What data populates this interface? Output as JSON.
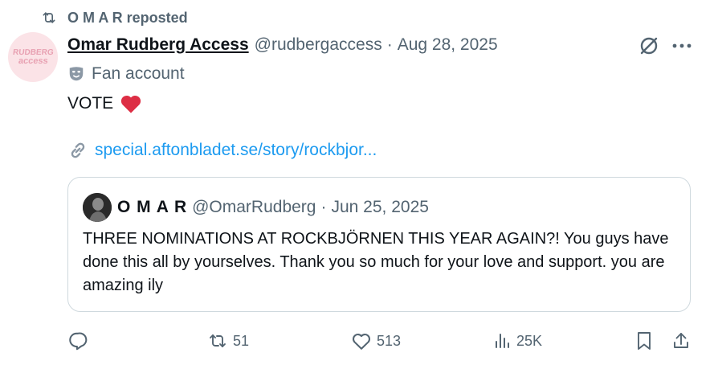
{
  "repost": {
    "text": "O M A R reposted"
  },
  "post": {
    "avatar_text_line1": "RUDBERG",
    "avatar_text_line2": "access",
    "author_name": "Omar Rudberg Access",
    "handle": "@rudbergaccess",
    "separator": "·",
    "date": "Aug 28, 2025",
    "account_label": "Fan account",
    "body": "VOTE",
    "link": "special.aftonbladet.se/story/rockbjor..."
  },
  "quote": {
    "author_name": "O M A R",
    "handle": "@OmarRudberg",
    "separator": "·",
    "date": "Jun 25, 2025",
    "text": "THREE NOMINATIONS AT ROCKBJÖRNEN THIS YEAR AGAIN?! You guys have done this all by yourselves. Thank you so much for your love and support. you are amazing ily"
  },
  "actions": {
    "reposts": "51",
    "likes": "513",
    "views": "25K"
  },
  "colors": {
    "accent_link": "#1d9bf0",
    "secondary_text": "#536471",
    "heart": "#f91880",
    "border": "#cfd9de"
  }
}
